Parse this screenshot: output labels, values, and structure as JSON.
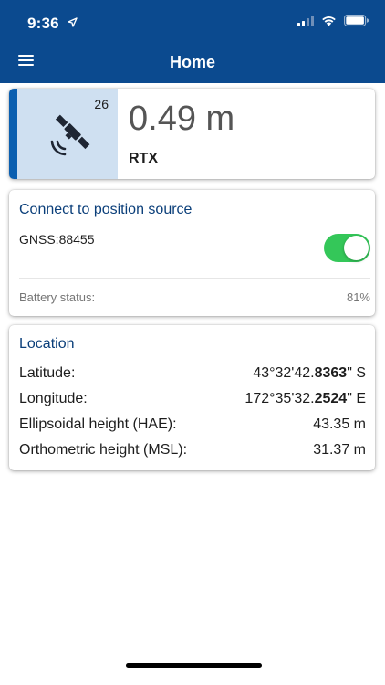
{
  "status_bar": {
    "time": "9:36"
  },
  "nav": {
    "title": "Home"
  },
  "accuracy": {
    "satellite_count": "26",
    "value": "0.49 m",
    "mode": "RTX"
  },
  "connection": {
    "title": "Connect to position source",
    "source_name": "GNSS:88455",
    "enabled": true,
    "battery_label": "Battery status:",
    "battery_value": "81%"
  },
  "location": {
    "title": "Location",
    "rows": [
      {
        "label": "Latitude:",
        "value_prefix": "43°32'42.",
        "value_bold": "8363",
        "value_suffix": "\" S"
      },
      {
        "label": "Longitude:",
        "value_prefix": "172°35'32.",
        "value_bold": "2524",
        "value_suffix": "\" E"
      },
      {
        "label": "Ellipsoidal height (HAE):",
        "value_prefix": "43.35 m",
        "value_bold": "",
        "value_suffix": ""
      },
      {
        "label": "Orthometric height (MSL):",
        "value_prefix": "31.37 m",
        "value_bold": "",
        "value_suffix": ""
      }
    ]
  },
  "colors": {
    "header": "#0b4a8f",
    "accent_stripe": "#0b5fb0",
    "satellite_panel": "#cfe0f1",
    "toggle_on": "#34c759",
    "section_title": "#0b3f7a"
  }
}
